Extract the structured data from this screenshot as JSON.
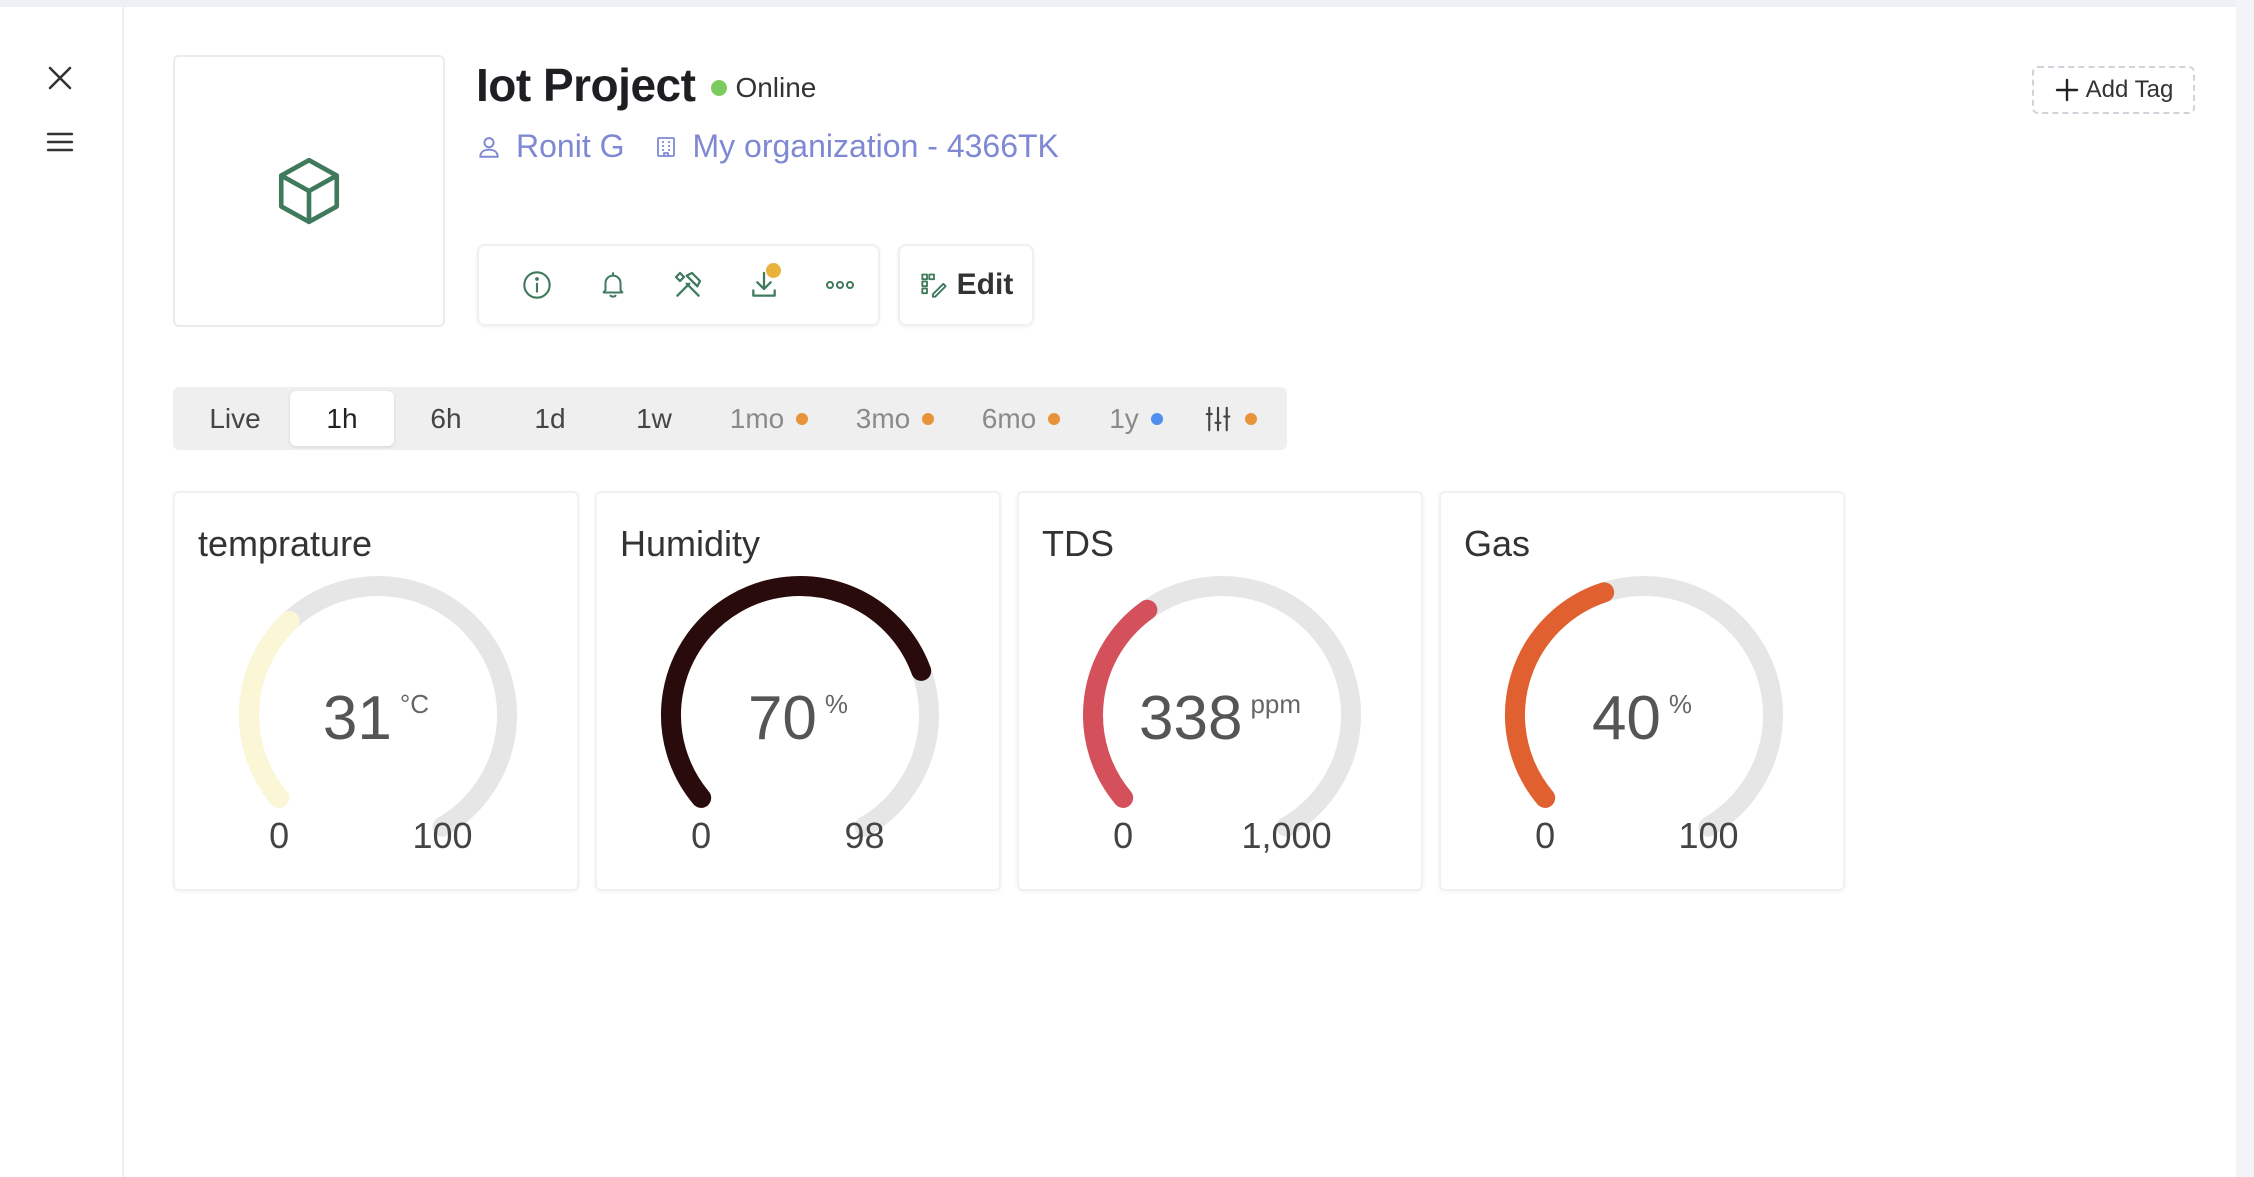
{
  "device": {
    "title": "Iot Project",
    "status": "Online",
    "owner": "Ronit G",
    "organization": "My organization - 4366TK"
  },
  "actions": {
    "edit_label": "Edit",
    "add_tag_label": "Add Tag"
  },
  "toolbar": {
    "items": [
      "info-icon",
      "bell-icon",
      "tools-icon",
      "download-icon",
      "more-icon"
    ]
  },
  "time_ranges": [
    {
      "label": "Live",
      "state": "normal"
    },
    {
      "label": "1h",
      "state": "active"
    },
    {
      "label": "6h",
      "state": "normal"
    },
    {
      "label": "1d",
      "state": "normal"
    },
    {
      "label": "1w",
      "state": "normal"
    },
    {
      "label": "1mo",
      "state": "muted",
      "dot": "#e8933a"
    },
    {
      "label": "3mo",
      "state": "muted",
      "dot": "#e8933a"
    },
    {
      "label": "6mo",
      "state": "muted",
      "dot": "#e8933a"
    },
    {
      "label": "1y",
      "state": "muted",
      "dot": "#4f8ff0"
    }
  ],
  "settings_dot_color": "#e8933a",
  "colors": {
    "online": "#7ccb62",
    "link": "#7f89d3",
    "icon_green": "#3f7a5c",
    "badge": "#e9b23c",
    "gauge_track": "#e6e6e6"
  },
  "gauges": [
    {
      "title": "temprature",
      "value": 31,
      "display": "31",
      "unit": "°C",
      "min": 0,
      "max": 100,
      "min_label": "0",
      "max_label": "100",
      "color": "#fbf6d6"
    },
    {
      "title": "Humidity",
      "value": 70,
      "display": "70",
      "unit": "%",
      "min": 0,
      "max": 98,
      "min_label": "0",
      "max_label": "98",
      "color": "#2a0b0b"
    },
    {
      "title": "TDS",
      "value": 338,
      "display": "338",
      "unit": "ppm",
      "min": 0,
      "max": 1000,
      "min_label": "0",
      "max_label": "1,000",
      "color": "#d4505a"
    },
    {
      "title": "Gas",
      "value": 40,
      "display": "40",
      "unit": "%",
      "min": 0,
      "max": 100,
      "min_label": "0",
      "max_label": "100",
      "color": "#e0602f"
    }
  ]
}
